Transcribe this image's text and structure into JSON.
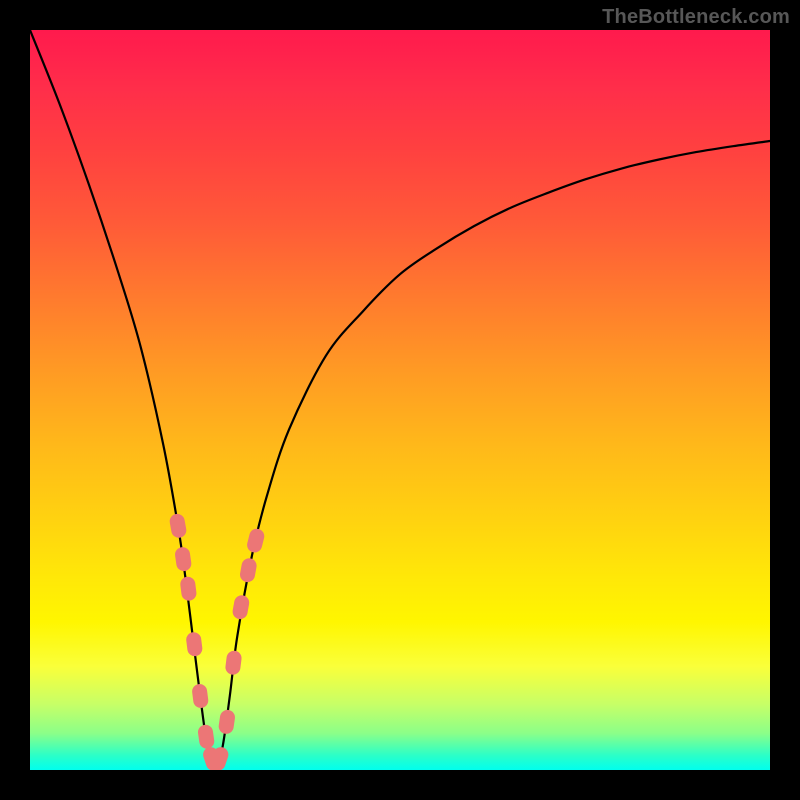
{
  "watermark": "TheBottleneck.com",
  "colors": {
    "background": "#000000",
    "curve": "#000000",
    "marker": "#ec7676",
    "gradient_top": "#ff1a4d",
    "gradient_bottom": "#00ffee"
  },
  "chart_data": {
    "type": "line",
    "title": "",
    "xlabel": "",
    "ylabel": "",
    "xlim": [
      0,
      100
    ],
    "ylim": [
      0,
      100
    ],
    "grid": false,
    "legend": false,
    "series": [
      {
        "name": "main-curve",
        "x": [
          0,
          4,
          8,
          12,
          15,
          18,
          20,
          21,
          22,
          23,
          24,
          25,
          26,
          27,
          28,
          30,
          32,
          35,
          40,
          45,
          50,
          55,
          60,
          65,
          70,
          75,
          80,
          85,
          90,
          95,
          100
        ],
        "values": [
          100,
          90,
          79,
          67,
          57,
          44,
          33,
          26,
          18,
          10,
          3,
          0,
          3,
          10,
          18,
          29,
          37,
          46,
          56,
          62,
          67,
          70.5,
          73.5,
          76,
          78,
          79.8,
          81.3,
          82.5,
          83.5,
          84.3,
          85
        ]
      },
      {
        "name": "highlight-points",
        "x": [
          20.0,
          20.7,
          21.4,
          22.2,
          23.0,
          23.8,
          24.6,
          25.6,
          26.6,
          27.5,
          28.5,
          29.5,
          30.5
        ],
        "values": [
          33.0,
          28.5,
          24.5,
          17.0,
          10.0,
          4.5,
          1.5,
          1.5,
          6.5,
          14.5,
          22.0,
          27.0,
          31.0
        ]
      }
    ]
  }
}
